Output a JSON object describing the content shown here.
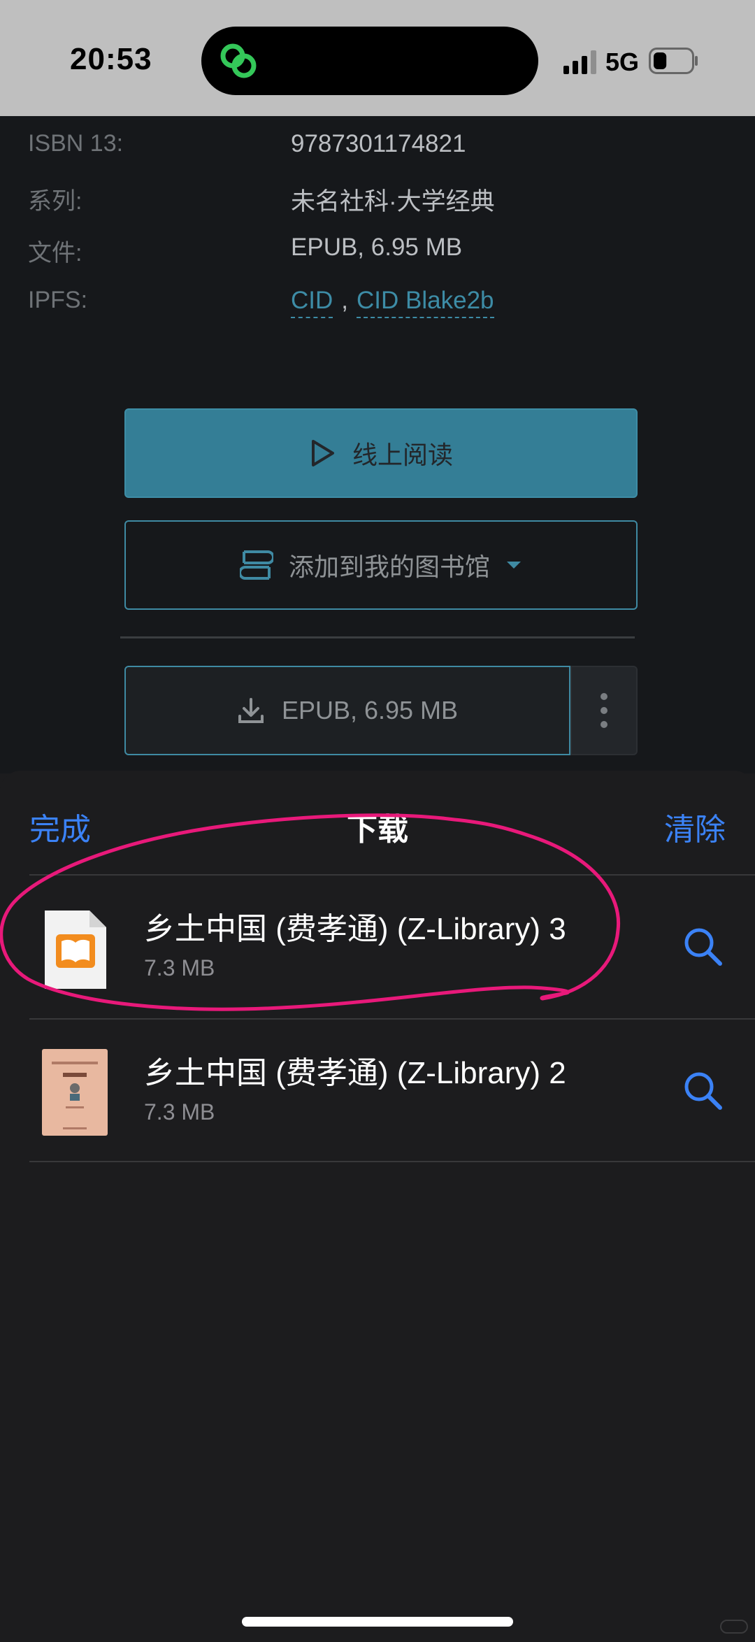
{
  "status_bar": {
    "time": "20:53",
    "network": "5G",
    "battery_level": 0.35
  },
  "book_meta": {
    "rows": [
      {
        "key": "ISBN 13:",
        "value": "9787301174821"
      },
      {
        "key": "系列:",
        "value": "未名社科·大学经典"
      },
      {
        "key": "文件:",
        "value": "EPUB, 6.95 MB"
      }
    ],
    "ipfs": {
      "key": "IPFS:",
      "link1": "CID",
      "separator": ",",
      "link2": "CID Blake2b"
    }
  },
  "actions": {
    "read_online": "线上阅读",
    "add_to_library": "添加到我的图书馆",
    "download": "EPUB, 6.95 MB"
  },
  "downloads_sheet": {
    "done": "完成",
    "title": "下载",
    "clear": "清除",
    "items": [
      {
        "name": "乡土中国 (费孝通) (Z-Library) 3",
        "size": "7.3 MB"
      },
      {
        "name": "乡土中国 (费孝通) (Z-Library) 2",
        "size": "7.3 MB"
      }
    ]
  },
  "colors": {
    "accent_blue": "#3b82f6",
    "teal": "#347e96",
    "annotation": "#e8197a"
  }
}
